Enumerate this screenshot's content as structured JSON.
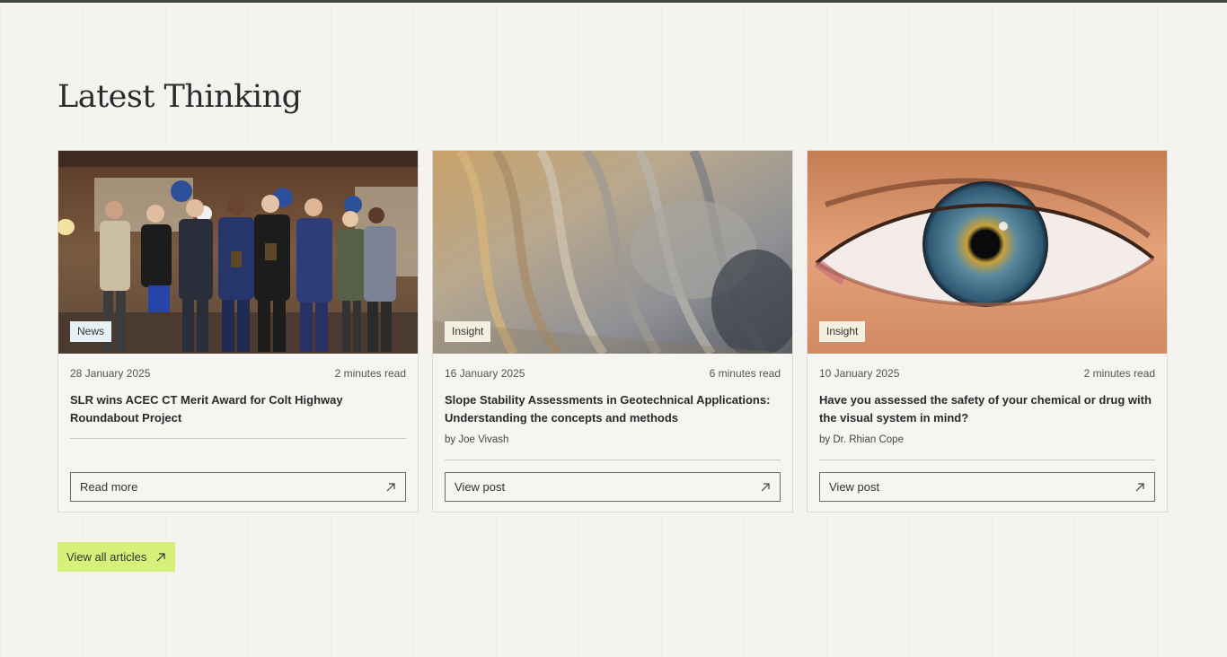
{
  "section": {
    "title": "Latest Thinking"
  },
  "cards": [
    {
      "tag": "News",
      "date": "28 January 2025",
      "read_time": "2 minutes read",
      "title": "SLR wins ACEC CT Merit Award for Colt Highway Roundabout Project",
      "author": "",
      "button_label": "Read more"
    },
    {
      "tag": "Insight",
      "date": "16 January 2025",
      "read_time": "6 minutes read",
      "title": "Slope Stability Assessments in Geotechnical Applications: Understanding the concepts and methods",
      "author": "by Joe Vivash",
      "button_label": "View post"
    },
    {
      "tag": "Insight",
      "date": "10 January 2025",
      "read_time": "2 minutes read",
      "title": "Have you assessed the safety of your chemical or drug with the visual system in mind?",
      "author": "by Dr. Rhian Cope",
      "button_label": "View post"
    }
  ],
  "view_all": {
    "label": "View all articles"
  },
  "colors": {
    "accent": "#d7f07a",
    "top_bar": "#3f4a3c",
    "news_tag": "#e6f1f4",
    "insight_tag": "#f3f0e2"
  },
  "icons": {
    "button_icon": "arrow-up-right-icon"
  }
}
